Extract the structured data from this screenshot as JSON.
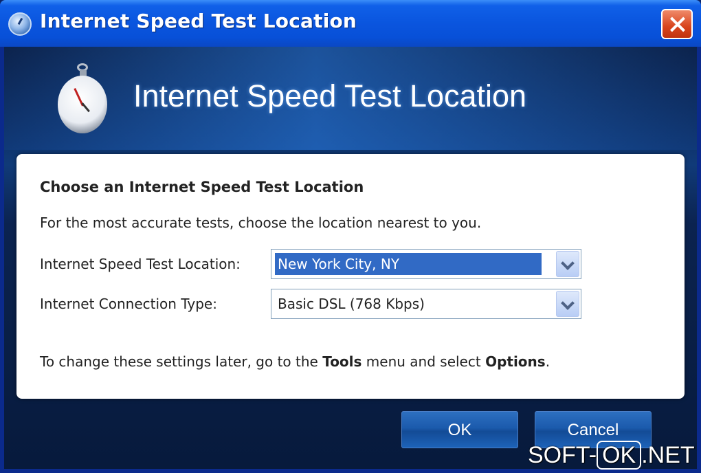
{
  "window": {
    "title": "Internet Speed Test Location"
  },
  "banner": {
    "title": "Internet Speed Test Location",
    "icon": "stopwatch-icon"
  },
  "panel": {
    "heading": "Choose an Internet Speed Test Location",
    "description": "For the most accurate tests, choose the location nearest to you.",
    "location_label": "Internet Speed Test Location:",
    "location_value": "New York City, NY",
    "connection_label": "Internet Connection Type:",
    "connection_value": "Basic DSL (768 Kbps)",
    "note_prefix": "To change these settings later, go to the ",
    "note_tools": "Tools",
    "note_middle": " menu and select ",
    "note_options": "Options",
    "note_suffix": "."
  },
  "buttons": {
    "ok": "OK",
    "cancel": "Cancel"
  },
  "watermark": {
    "left": "SOFT-",
    "box": "OK",
    "right": ".NET"
  },
  "colors": {
    "titlebar": "#0a55de",
    "selection": "#316ac5",
    "close_button": "#d8441c"
  }
}
